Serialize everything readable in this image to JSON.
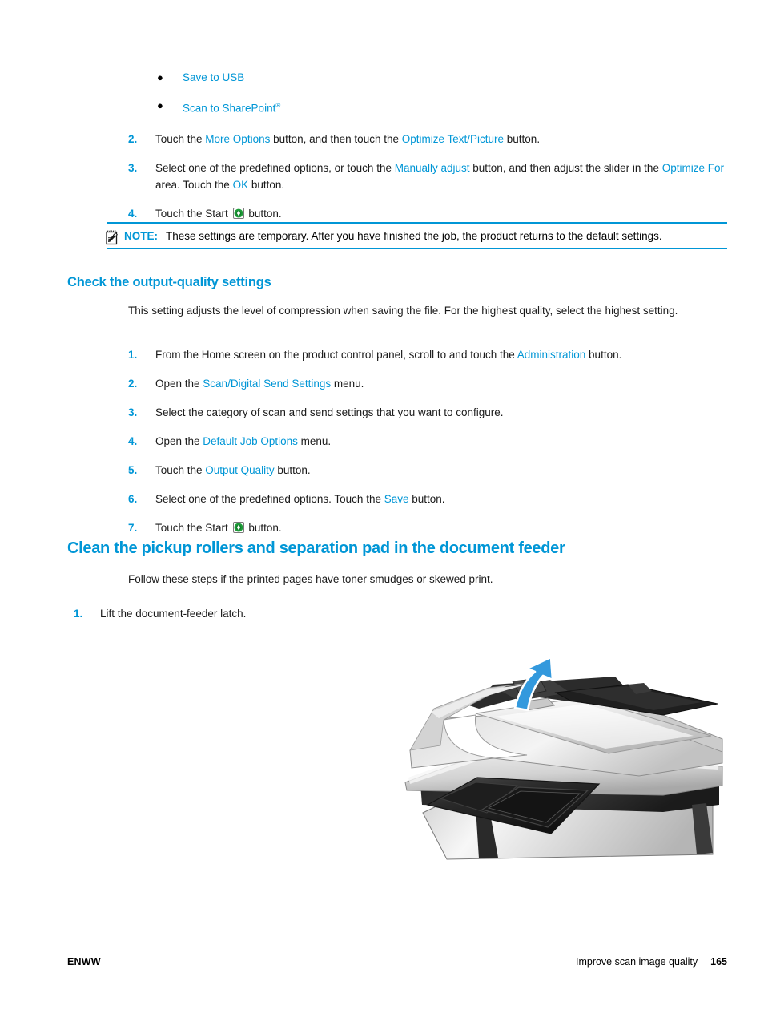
{
  "bullets": [
    {
      "label": "Save to USB",
      "sup": ""
    },
    {
      "label": "Scan to SharePoint",
      "sup": "®"
    }
  ],
  "steps_top": [
    {
      "num": "2.",
      "parts": [
        {
          "t": "Touch the ",
          "link": false
        },
        {
          "t": "More Options",
          "link": true
        },
        {
          "t": " button, and then touch the ",
          "link": false
        },
        {
          "t": "Optimize Text/Picture",
          "link": true
        },
        {
          "t": " button.",
          "link": false
        }
      ]
    },
    {
      "num": "3.",
      "parts": [
        {
          "t": "Select one of the predefined options, or touch the ",
          "link": false
        },
        {
          "t": "Manually adjust",
          "link": true
        },
        {
          "t": " button, and then adjust the slider in the ",
          "link": false
        },
        {
          "t": "Optimize For",
          "link": true
        },
        {
          "t": " area. Touch the ",
          "link": false
        },
        {
          "t": "OK",
          "link": true
        },
        {
          "t": " button.",
          "link": false
        }
      ]
    },
    {
      "num": "4.",
      "parts": [
        {
          "t": "Touch the Start ",
          "link": false
        },
        {
          "t": "start-icon",
          "icon": true
        },
        {
          "t": " button.",
          "link": false
        }
      ]
    }
  ],
  "note": {
    "icon": "note-pad-pencil-icon",
    "label": "NOTE:",
    "text": "These settings are temporary. After you have finished the job, the product returns to the default settings."
  },
  "section_output_quality": {
    "heading": "Check the output-quality settings",
    "intro": "This setting adjusts the level of compression when saving the file. For the highest quality, select the highest setting.",
    "steps": [
      {
        "num": "1.",
        "parts": [
          {
            "t": "From the Home screen on the product control panel, scroll to and touch the ",
            "link": false
          },
          {
            "t": "Administration",
            "link": true
          },
          {
            "t": " button.",
            "link": false
          }
        ]
      },
      {
        "num": "2.",
        "parts": [
          {
            "t": "Open the ",
            "link": false
          },
          {
            "t": "Scan/Digital Send Settings",
            "link": true
          },
          {
            "t": " menu.",
            "link": false
          }
        ]
      },
      {
        "num": "3.",
        "parts": [
          {
            "t": "Select the category of scan and send settings that you want to configure.",
            "link": false
          }
        ]
      },
      {
        "num": "4.",
        "parts": [
          {
            "t": "Open the ",
            "link": false
          },
          {
            "t": "Default Job Options",
            "link": true
          },
          {
            "t": " menu.",
            "link": false
          }
        ]
      },
      {
        "num": "5.",
        "parts": [
          {
            "t": "Touch the ",
            "link": false
          },
          {
            "t": "Output Quality",
            "link": true
          },
          {
            "t": " button.",
            "link": false
          }
        ]
      },
      {
        "num": "6.",
        "parts": [
          {
            "t": "Select one of the predefined options. Touch the ",
            "link": false
          },
          {
            "t": "Save",
            "link": true
          },
          {
            "t": " button.",
            "link": false
          }
        ]
      },
      {
        "num": "7.",
        "parts": [
          {
            "t": "Touch the Start ",
            "link": false
          },
          {
            "t": "start-icon",
            "icon": true
          },
          {
            "t": " button.",
            "link": false
          }
        ]
      }
    ]
  },
  "section_clean_rollers": {
    "heading": "Clean the pickup rollers and separation pad in the document feeder",
    "intro": "Follow these steps if the printed pages have toner smudges or skewed print.",
    "steps": [
      {
        "num": "1.",
        "parts": [
          {
            "t": "Lift the document-feeder latch.",
            "link": false
          }
        ]
      }
    ],
    "illustration": {
      "name": "document-feeder-latch-illustration",
      "arrow": "lift-arrow-up",
      "arrow_color": "#3399dd"
    }
  },
  "footer": {
    "left": "ENWW",
    "right_label": "Improve scan image quality",
    "page_number": "165"
  },
  "colors": {
    "link": "#0096d6",
    "heading": "#0096d6",
    "text": "#1a1a1a",
    "rule": "#0096d6",
    "arrow": "#3399dd"
  }
}
